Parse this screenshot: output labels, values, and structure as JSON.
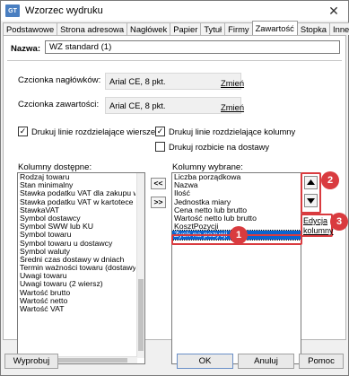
{
  "window": {
    "title": "Wzorzec wydruku",
    "app_icon_text": "GT"
  },
  "tabs": [
    {
      "label": "Podstawowe"
    },
    {
      "label": "Strona adresowa"
    },
    {
      "label": "Nagłówek"
    },
    {
      "label": "Papier"
    },
    {
      "label": "Tytuł"
    },
    {
      "label": "Firmy"
    },
    {
      "label": "Zawartość",
      "active": true
    },
    {
      "label": "Stopka"
    },
    {
      "label": "Inne"
    }
  ],
  "name": {
    "label": "Nazwa:",
    "value": "WZ standard (1)"
  },
  "fonts": {
    "header_label": "Czcionka nagłówków:",
    "header_value": "Arial CE, 8 pkt.",
    "content_label": "Czcionka zawartości:",
    "content_value": "Arial CE, 8 pkt.",
    "change_label": "Zmień"
  },
  "checkboxes": {
    "row_lines": {
      "label": "Drukuj linie rozdzielające wiersze",
      "checked": true
    },
    "col_lines": {
      "label": "Drukuj linie rozdzielające kolumny",
      "checked": true
    },
    "delivery_breakdown": {
      "label": "Drukuj rozbicie na dostawy",
      "checked": false
    }
  },
  "available_columns": {
    "label": "Kolumny dostępne:",
    "items": [
      "Rodzaj towaru",
      "Stan minimalny",
      "Stawka podatku VAT dla zakupu w",
      "Stawka podatku VAT w kartotece t",
      "StawkaVAT",
      "Symbol dostawcy",
      "Symbol SWW lub KU",
      "Symbol towaru",
      "Symbol towaru u dostawcy",
      "Symbol waluty",
      "Średni czas dostawy w dniach",
      "Termin ważności towaru (dostawy)",
      "Uwagi towaru",
      "Uwagi towaru (2 wiersz)",
      "Wartość brutto",
      "Wartość netto",
      "Wartość VAT"
    ]
  },
  "selected_columns": {
    "label": "Kolumny wybrane:",
    "items": [
      "Liczba porządkowa",
      "Nazwa",
      "Ilość",
      "Jednostka miary",
      "Cena netto lub brutto",
      "Wartość netto lub brutto",
      "KosztPozycji",
      "Zysk na pozycji"
    ],
    "selected_index": 7
  },
  "move_buttons": {
    "add_all": "<<",
    "remove_all": ">>"
  },
  "edit_columns": {
    "line1": "Edycja",
    "line2": "kolumny"
  },
  "annotations": {
    "badge1": "1",
    "badge2": "2",
    "badge3": "3",
    "color": "#d93b3f"
  },
  "footer": {
    "print_label": "Wyprobuj",
    "ok_label": "OK",
    "cancel_label": "Anuluj",
    "help_label": "Pomoc"
  }
}
